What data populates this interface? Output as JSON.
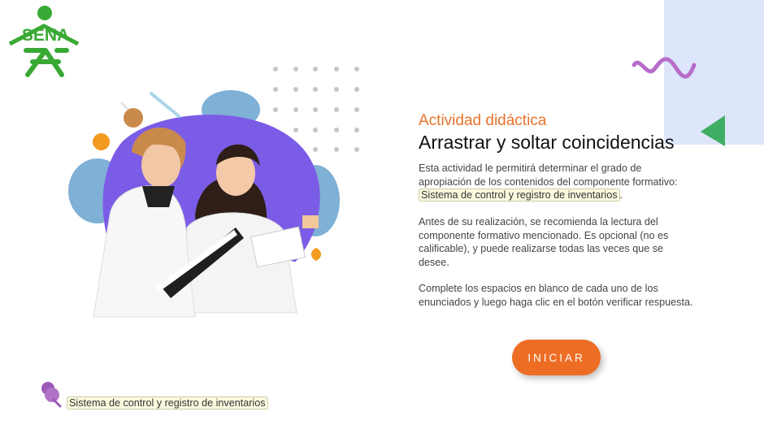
{
  "logo": {
    "text": "SENA",
    "color": "#39a935"
  },
  "content": {
    "subtitle": "Actividad didáctica",
    "title": "Arrastrar y soltar coincidencias",
    "p1_text": "Esta actividad le permitirá determinar el grado de apropiación de los contenidos del componente formativo: ",
    "p1_link": "Sistema de control y registro de inventarios",
    "p1_end": ".",
    "p2": "Antes de su realización, se recomienda la lectura del componente formativo mencionado. Es opcional (no es calificable), y puede realizarse todas las veces que se desee.",
    "p3": "Complete los espacios en blanco de cada uno de los enunciados y luego haga clic en el botón verificar respuesta."
  },
  "button": {
    "label": "INICIAR",
    "color": "#ee6d24"
  },
  "footer": {
    "link": "Sistema de control y registro de inventarios"
  },
  "colors": {
    "accent_orange": "#e8732a",
    "panel_blue": "#dde6fb",
    "wave_purple": "#b86cc9",
    "triangle_green": "#3fae62",
    "blob_purple": "#7b5ce6",
    "blob_blue": "#7fb0d6"
  },
  "icons": [
    "sena-logo-icon",
    "wave-decoration-icon",
    "triangle-decoration-icon",
    "pin-icon"
  ]
}
